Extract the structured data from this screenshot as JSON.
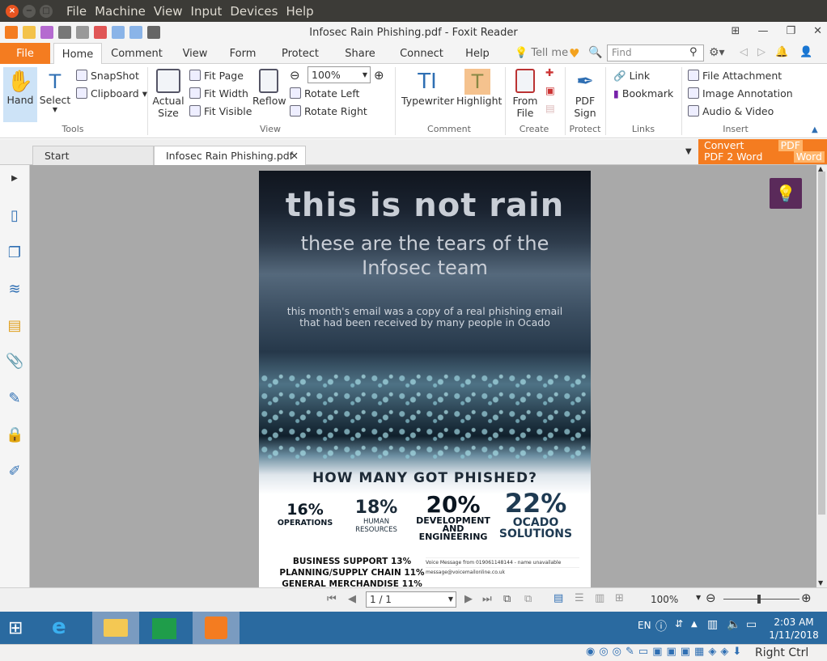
{
  "vbox": {
    "menus": [
      "File",
      "Machine",
      "View",
      "Input",
      "Devices",
      "Help"
    ]
  },
  "window": {
    "title": "Infosec Rain Phishing.pdf - Foxit Reader"
  },
  "ribbon_tabs": [
    "File",
    "Home",
    "Comment",
    "View",
    "Form",
    "Protect",
    "Share",
    "Connect",
    "Help"
  ],
  "tell_me": "Tell me",
  "find_placeholder": "Find",
  "ribbon": {
    "hand": "Hand",
    "select": "Select",
    "snapshot": "SnapShot",
    "clipboard": "Clipboard",
    "tools_group": "Tools",
    "actual_size": "Actual Size",
    "fit_page": "Fit Page",
    "fit_width": "Fit Width",
    "fit_visible": "Fit Visible",
    "reflow": "Reflow",
    "zoom": "100%",
    "rotate_left": "Rotate Left",
    "rotate_right": "Rotate Right",
    "view_group": "View",
    "typewriter": "Typewriter",
    "highlight": "Highlight",
    "comment_group": "Comment",
    "from_file": "From File",
    "create_group": "Create",
    "pdf_sign": "PDF Sign",
    "protect_group": "Protect",
    "link": "Link",
    "bookmark": "Bookmark",
    "links_group": "Links",
    "file_attachment": "File Attachment",
    "image_annotation": "Image Annotation",
    "audio_video": "Audio & Video",
    "insert_group": "Insert"
  },
  "doc_tabs": {
    "start": "Start",
    "active": "Infosec Rain Phishing.pdf"
  },
  "convert": {
    "line1": "Convert",
    "line2": "PDF 2 Word",
    "badge1": "PDF",
    "badge2": "Word"
  },
  "pdf": {
    "headline": "this is not rain",
    "subhead1": "these are the tears of the",
    "subhead2": "Infosec team",
    "body1": "this month's email was a copy of a real phishing email",
    "body2": "that had been received by many people in Ocado",
    "question": "HOW MANY GOT PHISHED?",
    "stats": [
      {
        "pct": "16%",
        "label": "OPERATIONS"
      },
      {
        "pct": "18%",
        "label": "HUMAN RESOURCES"
      },
      {
        "pct": "20%",
        "label": "DEVELOPMENT AND ENGINEERING"
      },
      {
        "pct": "22%",
        "label": "OCADO SOLUTIONS"
      }
    ],
    "list": [
      "BUSINESS SUPPORT 13%",
      "PLANNING/SUPPLY CHAIN 11%",
      "GENERAL MERCHANDISE 11%"
    ],
    "email_subject": "Voice Message from 019061148144 - name unavailable",
    "email_from": "message@voicemailonline.co.uk"
  },
  "nav": {
    "page": "1 / 1",
    "zoom": "100%"
  },
  "taskbar": {
    "lang": "EN",
    "time": "2:03 AM",
    "date": "1/11/2018"
  },
  "vbox_status": {
    "hostkey": "Right Ctrl"
  }
}
